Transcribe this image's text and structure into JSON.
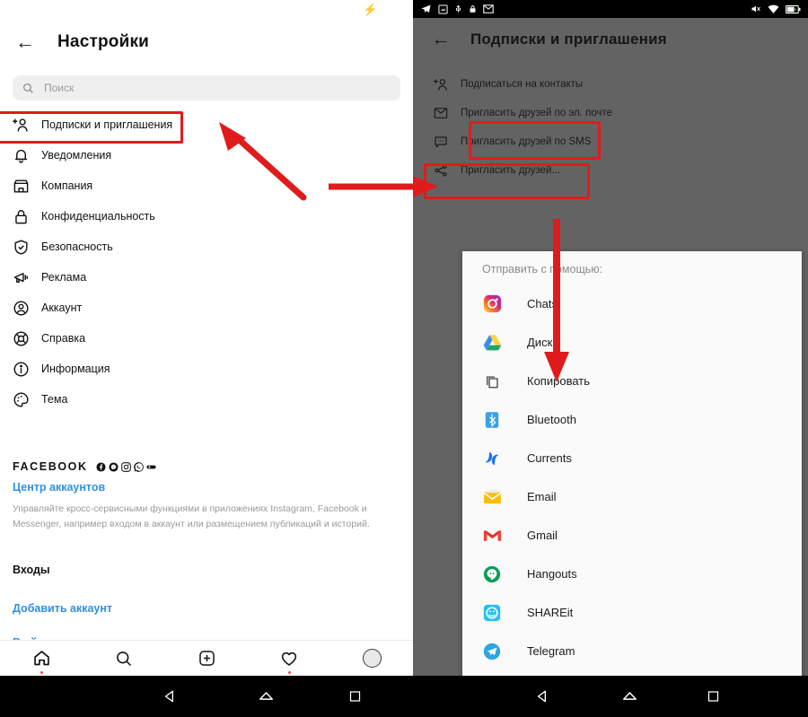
{
  "left_phone": {
    "status_bar": {
      "charge_icon": "lightning-bolt-icon"
    },
    "header": {
      "back_icon": "back-arrow-icon",
      "title": "Настройки"
    },
    "search": {
      "icon": "search-icon",
      "placeholder": "Поиск",
      "value": ""
    },
    "menu_items": [
      {
        "icon": "add-person-icon",
        "label": "Подписки и приглашения",
        "highlighted": true
      },
      {
        "icon": "bell-icon",
        "label": "Уведомления"
      },
      {
        "icon": "storefront-icon",
        "label": "Компания"
      },
      {
        "icon": "lock-icon",
        "label": "Конфиденциальность"
      },
      {
        "icon": "shield-check-icon",
        "label": "Безопасность"
      },
      {
        "icon": "megaphone-icon",
        "label": "Реклама"
      },
      {
        "icon": "account-circle-icon",
        "label": "Аккаунт"
      },
      {
        "icon": "lifebuoy-icon",
        "label": "Справка"
      },
      {
        "icon": "info-circle-icon",
        "label": "Информация"
      },
      {
        "icon": "palette-icon",
        "label": "Тема"
      }
    ],
    "facebook_section": {
      "brand": "FACEBOOK",
      "logos": [
        "facebook-icon",
        "messenger-icon",
        "instagram-icon",
        "whatsapp-icon",
        "portal-icon"
      ],
      "accounts_center_link": "Центр аккаунтов",
      "description": "Управляйте кросс-сервисными функциями в приложениях Instagram, Facebook и Messenger, например входом в аккаунт или размещением публикаций и историй."
    },
    "logins_section": {
      "title": "Входы",
      "add_account_link": "Добавить аккаунт",
      "logout_link": "Выйти"
    },
    "bottom_nav": [
      {
        "icon": "home-icon",
        "badge_dot": true
      },
      {
        "icon": "search-icon",
        "badge_dot": false
      },
      {
        "icon": "add-post-icon",
        "badge_dot": false
      },
      {
        "icon": "heart-icon",
        "badge_dot": true
      },
      {
        "icon": "avatar-icon",
        "badge_dot": false
      }
    ],
    "system_nav": [
      "back-triangle-icon",
      "home-pentagon-icon",
      "recents-square-icon"
    ]
  },
  "right_phone": {
    "status_bar": {
      "left_icons": [
        "telegram-icon",
        "screenshot-icon",
        "usb-icon",
        "lock-icon",
        "email-icon"
      ],
      "right_icons": [
        "mute-icon",
        "wifi-icon",
        "battery-charging-icon"
      ]
    },
    "header": {
      "back_icon": "back-arrow-icon",
      "title": "Подписки и приглашения"
    },
    "menu_items": [
      {
        "icon": "add-person-icon",
        "label": "Подписаться на контакты"
      },
      {
        "icon": "envelope-icon",
        "label": "Пригласить друзей по эл. почте"
      },
      {
        "icon": "sms-bubble-icon",
        "label": "Пригласить друзей по SMS"
      },
      {
        "icon": "share-nodes-icon",
        "label": "Пригласить друзей...",
        "highlighted": true
      }
    ],
    "share_sheet": {
      "title": "Отправить с помощью:",
      "apps": [
        {
          "icon": "instagram-icon",
          "label": "Chats"
        },
        {
          "icon": "google-drive-icon",
          "label": "Диск"
        },
        {
          "icon": "copy-icon",
          "label": "Копировать",
          "highlighted": true
        },
        {
          "icon": "bluetooth-icon",
          "label": "Bluetooth"
        },
        {
          "icon": "currents-icon",
          "label": "Currents"
        },
        {
          "icon": "email-envelope-icon",
          "label": "Email"
        },
        {
          "icon": "gmail-icon",
          "label": "Gmail"
        },
        {
          "icon": "hangouts-icon",
          "label": "Hangouts"
        },
        {
          "icon": "shareit-icon",
          "label": "SHAREit"
        },
        {
          "icon": "telegram-icon",
          "label": "Telegram"
        }
      ]
    },
    "system_nav": [
      "back-triangle-icon",
      "home-pentagon-icon",
      "recents-square-icon"
    ]
  },
  "annotations": {
    "accent_color": "#e01b1b",
    "arrows": [
      {
        "name": "arrow-to-subscriptions",
        "direction": "up-left"
      },
      {
        "name": "arrow-to-invite-friends",
        "direction": "right"
      },
      {
        "name": "arrow-to-copy",
        "direction": "down"
      }
    ]
  }
}
